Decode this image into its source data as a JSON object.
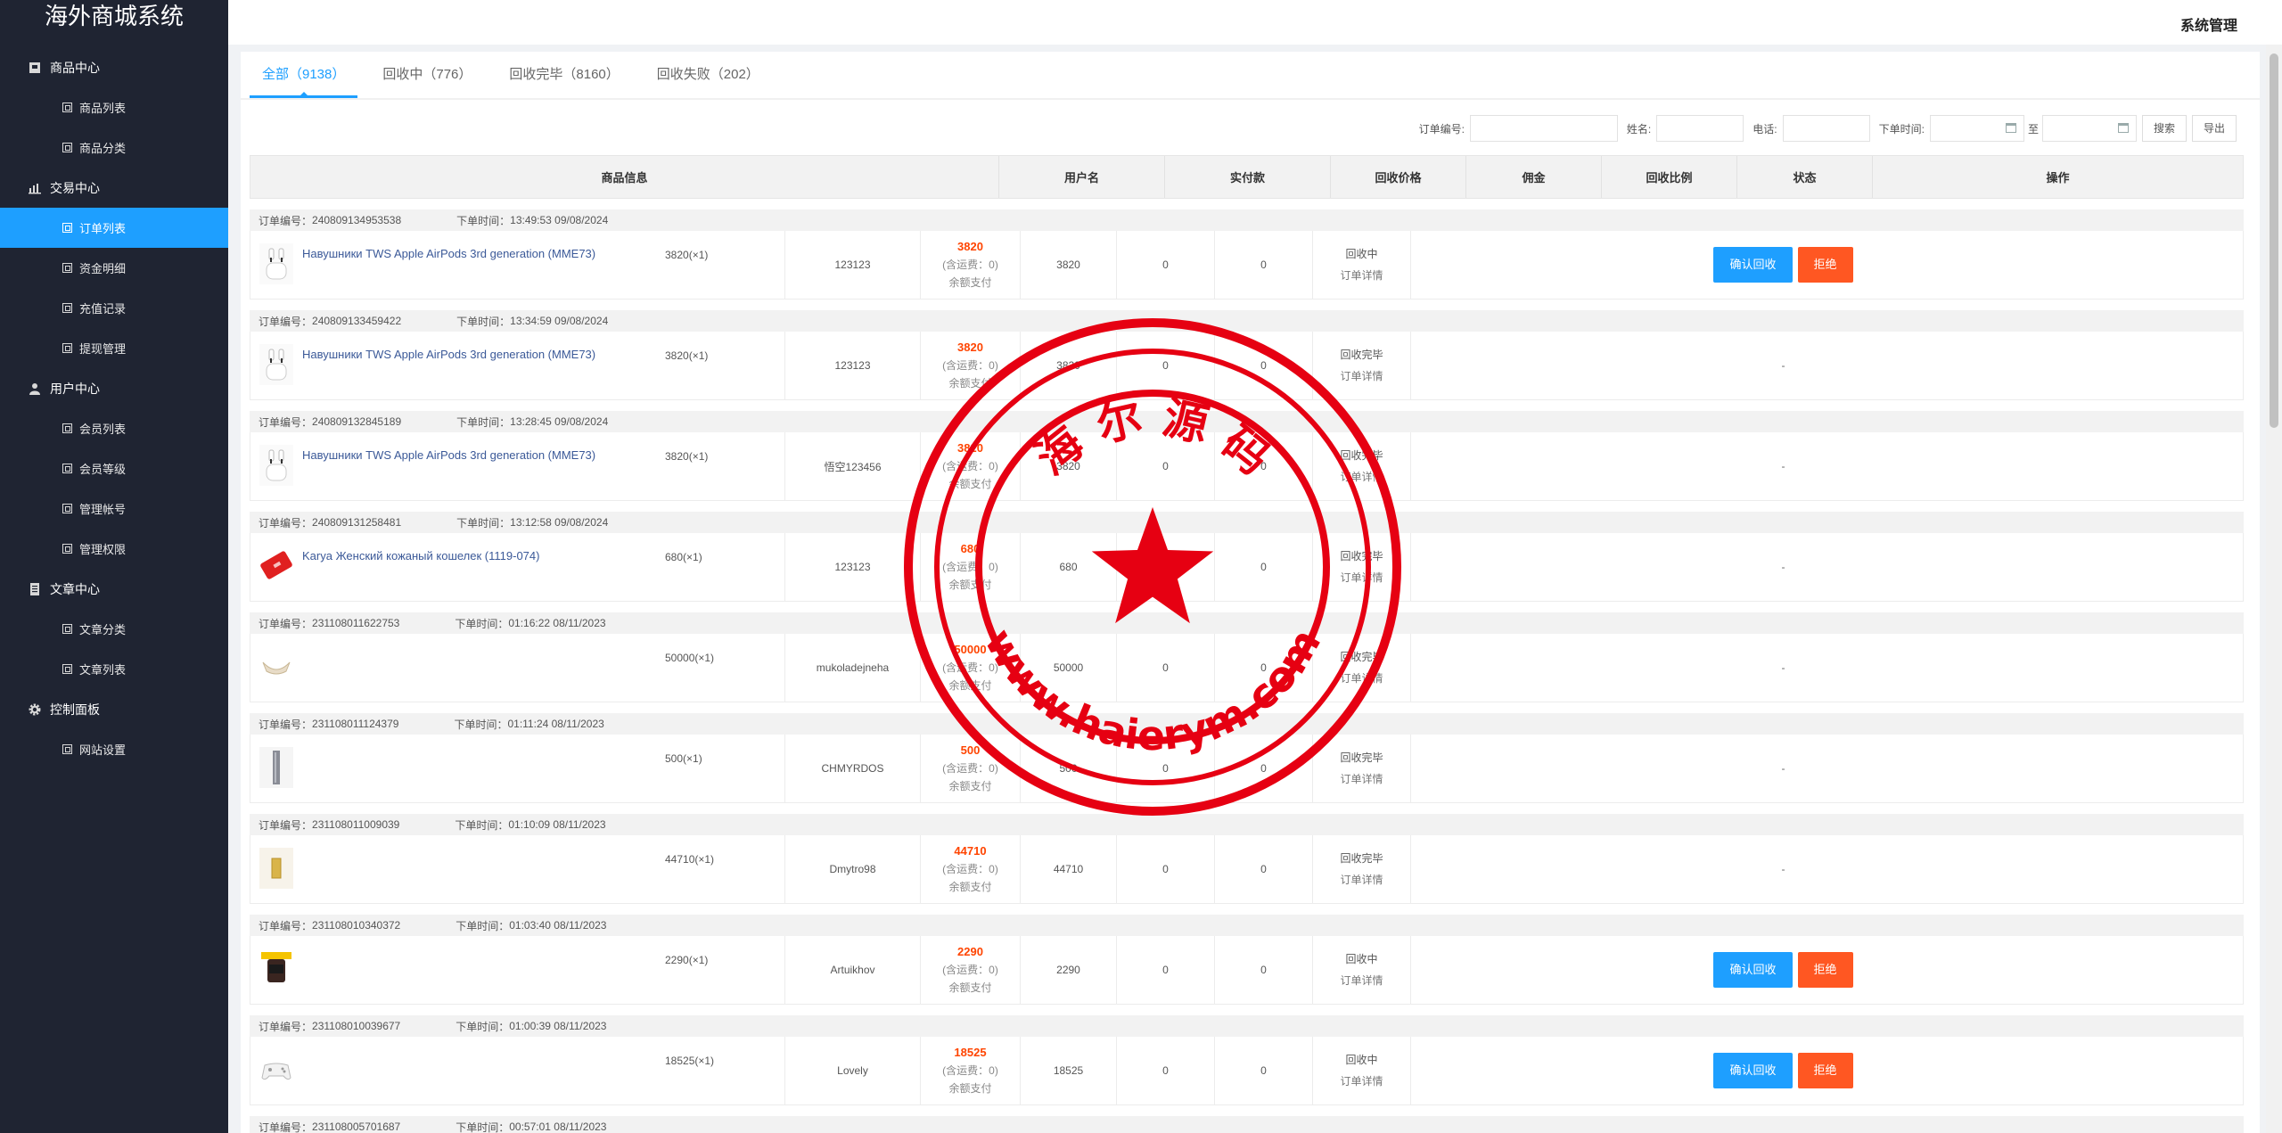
{
  "sidebar": {
    "logo": "海外商城系统",
    "groups": [
      {
        "label": "商品中心",
        "icon": "product-icon",
        "items": [
          "商品列表",
          "商品分类"
        ]
      },
      {
        "label": "交易中心",
        "icon": "bar-chart-icon",
        "items": [
          "订单列表",
          "资金明细",
          "充值记录",
          "提现管理"
        ]
      },
      {
        "label": "用户中心",
        "icon": "user-icon",
        "items": [
          "会员列表",
          "会员等级",
          "管理帐号",
          "管理权限"
        ]
      },
      {
        "label": "文章中心",
        "icon": "document-icon",
        "items": [
          "文章分类",
          "文章列表"
        ]
      },
      {
        "label": "控制面板",
        "icon": "gear-icon",
        "items": [
          "网站设置"
        ]
      }
    ],
    "active_item": "订单列表"
  },
  "header": {
    "title": "系统管理"
  },
  "tabs": [
    {
      "label": "全部（9138）",
      "active": true
    },
    {
      "label": "回收中（776）",
      "active": false
    },
    {
      "label": "回收完毕（8160）",
      "active": false
    },
    {
      "label": "回收失败（202）",
      "active": false
    }
  ],
  "filters": {
    "order_no_label": "订单编号:",
    "name_label": "姓名:",
    "phone_label": "电话:",
    "time_label": "下单时间:",
    "to_label": "至",
    "search_btn": "搜索",
    "export_btn": "导出"
  },
  "columns": [
    "商品信息",
    "用户名",
    "实付款",
    "回收价格",
    "佣金",
    "回收比例",
    "状态",
    "操作"
  ],
  "labels": {
    "order_no_prefix": "订单编号：",
    "order_time_prefix": "下单时间：",
    "shipping": "(含运费：0)",
    "pay_method": "余额支付",
    "detail": "订单详情",
    "confirm": "确认回收",
    "reject": "拒绝",
    "dash": "-"
  },
  "orders": [
    {
      "no": "240809134953538",
      "time": "13:49:53 09/08/2024",
      "goods": "Навушники TWS Apple AirPods 3rd generation (MME73)",
      "qty": "3820(×1)",
      "img": "airpods",
      "user": "123123",
      "paid": "3820",
      "price": "3820",
      "commission": "0",
      "ratio": "0",
      "status": "回收中",
      "actions": true
    },
    {
      "no": "240809133459422",
      "time": "13:34:59 09/08/2024",
      "goods": "Навушники TWS Apple AirPods 3rd generation (MME73)",
      "qty": "3820(×1)",
      "img": "airpods",
      "user": "123123",
      "paid": "3820",
      "price": "3820",
      "commission": "0",
      "ratio": "0",
      "status": "回收完毕",
      "actions": false
    },
    {
      "no": "240809132845189",
      "time": "13:28:45 09/08/2024",
      "goods": "Навушники TWS Apple AirPods 3rd generation (MME73)",
      "qty": "3820(×1)",
      "img": "airpods",
      "user": "悟空123456",
      "paid": "3820",
      "price": "3820",
      "commission": "0",
      "ratio": "0",
      "status": "回收完毕",
      "actions": false
    },
    {
      "no": "240809131258481",
      "time": "13:12:58 09/08/2024",
      "goods": "Karya Женский кожаный кошелек (1119-074)",
      "qty": "680(×1)",
      "img": "wallet",
      "user": "123123",
      "paid": "680",
      "price": "680",
      "commission": "0",
      "ratio": "0",
      "status": "回收完毕",
      "actions": false
    },
    {
      "no": "231108011622753",
      "time": "01:16:22 08/11/2023",
      "goods": "",
      "qty": "50000(×1)",
      "img": "ring",
      "user": "mukoladejneha",
      "paid": "50000",
      "price": "50000",
      "commission": "0",
      "ratio": "0",
      "status": "回收完毕",
      "actions": false
    },
    {
      "no": "231108011124379",
      "time": "01:11:24 08/11/2023",
      "goods": "",
      "qty": "500(×1)",
      "img": "bottle",
      "user": "CHMYRDOS",
      "paid": "500",
      "price": "500",
      "commission": "0",
      "ratio": "0",
      "status": "回收完毕",
      "actions": false
    },
    {
      "no": "231108011009039",
      "time": "01:10:09 08/11/2023",
      "goods": "",
      "qty": "44710(×1)",
      "img": "gold",
      "user": "Dmytro98",
      "paid": "44710",
      "price": "44710",
      "commission": "0",
      "ratio": "0",
      "status": "回收完毕",
      "actions": false
    },
    {
      "no": "231108010340372",
      "time": "01:03:40 08/11/2023",
      "goods": "",
      "qty": "2290(×1)",
      "img": "jar",
      "user": "Artuikhov",
      "paid": "2290",
      "price": "2290",
      "commission": "0",
      "ratio": "0",
      "status": "回收中",
      "actions": true
    },
    {
      "no": "231108010039677",
      "time": "01:00:39 08/11/2023",
      "goods": "",
      "qty": "18525(×1)",
      "img": "gamepad",
      "user": "Lovely",
      "paid": "18525",
      "price": "18525",
      "commission": "0",
      "ratio": "0",
      "status": "回收中",
      "actions": true
    },
    {
      "no": "231108005701687",
      "time": "00:57:01 08/11/2023",
      "goods": "",
      "qty": "",
      "img": "none",
      "user": "",
      "paid": "",
      "price": "",
      "commission": "",
      "ratio": "",
      "status": "",
      "actions": false
    }
  ],
  "watermark": {
    "top_text": "海 尔 源 码",
    "bottom_text": "www.haierym.com",
    "color": "#e60012"
  },
  "colors": {
    "accent": "#1e9fff",
    "reject": "#ff5722",
    "price": "#ff4400",
    "sidebar_bg": "#1f2432"
  }
}
